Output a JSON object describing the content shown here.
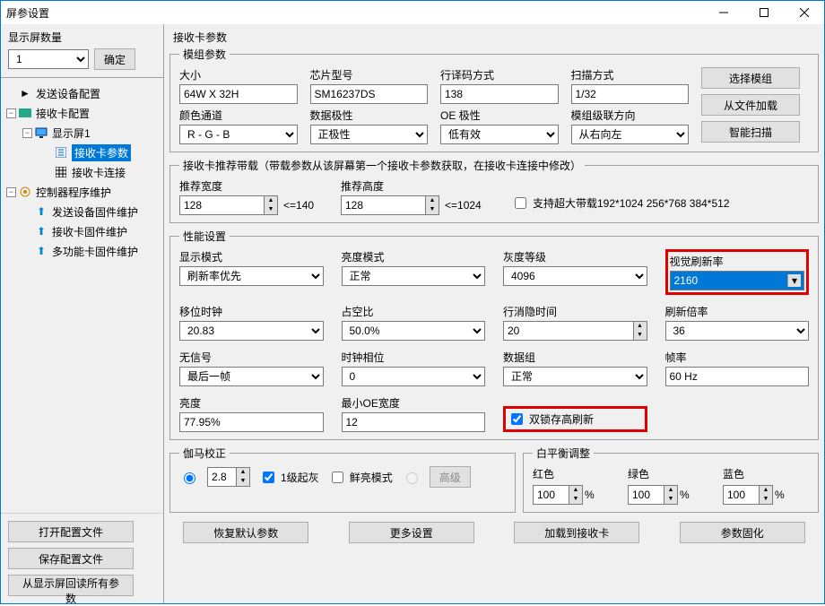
{
  "window": {
    "title": "屏参设置"
  },
  "left": {
    "count_label": "显示屏数量",
    "count_value": "1",
    "confirm": "确定",
    "tree": {
      "send_cfg": "发送设备配置",
      "recv_cfg": "接收卡配置",
      "screen1": "显示屏1",
      "recv_params": "接收卡参数",
      "recv_conn": "接收卡连接",
      "ctrl_fw": "控制器程序维护",
      "send_fw": "发送设备固件维护",
      "recv_fw": "接收卡固件维护",
      "multi_fw": "多功能卡固件维护"
    },
    "buttons": {
      "open": "打开配置文件",
      "save": "保存配置文件",
      "readback": "从显示屏回读所有参数"
    }
  },
  "right_title": "接收卡参数",
  "module": {
    "legend": "模组参数",
    "size_l": "大小",
    "size_v": "64W X 32H",
    "chip_l": "芯片型号",
    "chip_v": "SM16237DS",
    "decode_l": "行译码方式",
    "decode_v": "138",
    "scan_l": "扫描方式",
    "scan_v": "1/32",
    "color_l": "颜色通道",
    "color_v": "R - G - B",
    "polarity_l": "数据极性",
    "polarity_v": "正极性",
    "oe_l": "OE 极性",
    "oe_v": "低有效",
    "cascade_l": "模组级联方向",
    "cascade_v": "从右向左",
    "btn_sel": "选择模组",
    "btn_load": "从文件加载",
    "btn_scan": "智能扫描"
  },
  "reco": {
    "legend": "接收卡推荐带载（带载参数从该屏幕第一个接收卡参数获取，在接收卡连接中修改）",
    "w_l": "推荐宽度",
    "w_v": "128",
    "w_lim": "<=140",
    "h_l": "推荐高度",
    "h_v": "128",
    "h_lim": "<=1024",
    "big": "支持超大带载192*1024 256*768 384*512"
  },
  "perf": {
    "legend": "性能设置",
    "disp_mode_l": "显示模式",
    "disp_mode_v": "刷新率优先",
    "bright_mode_l": "亮度模式",
    "bright_mode_v": "正常",
    "gray_l": "灰度等级",
    "gray_v": "4096",
    "vrefresh_l": "视觉刷新率",
    "vrefresh_v": "2160",
    "shift_l": "移位时钟",
    "shift_v": "20.83",
    "duty_l": "占空比",
    "duty_v": "50.0%",
    "blank_l": "行消隐时间",
    "blank_v": "20",
    "mult_l": "刷新倍率",
    "mult_v": "36",
    "nosig_l": "无信号",
    "nosig_v": "最后一帧",
    "phase_l": "时钟相位",
    "phase_v": "0",
    "dgrp_l": "数据组",
    "dgrp_v": "正常",
    "fps_l": "帧率",
    "fps_v": "60 Hz",
    "bright_l": "亮度",
    "bright_v": "77.95%",
    "minoe_l": "最小OE宽度",
    "minoe_v": "12",
    "dual_latch": "双锁存高刷新"
  },
  "gamma": {
    "legend": "伽马校正",
    "val": "2.8",
    "level1": "1级起灰",
    "fresh": "鲜亮模式",
    "adv": "高级"
  },
  "wb": {
    "legend": "白平衡调整",
    "r": "红色",
    "g": "绿色",
    "b": "蓝色",
    "rv": "100",
    "gv": "100",
    "bv": "100",
    "pct": "%"
  },
  "actions": {
    "restore": "恢复默认参数",
    "more": "更多设置",
    "load": "加载到接收卡",
    "solidify": "参数固化"
  }
}
